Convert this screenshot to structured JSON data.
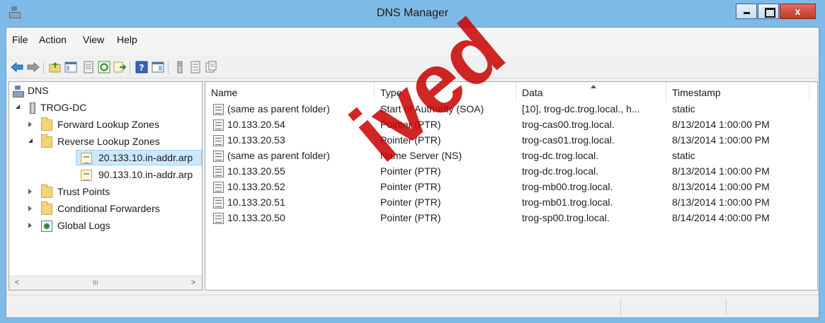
{
  "window": {
    "title": "DNS Manager",
    "close_glyph": "x"
  },
  "menu": [
    "File",
    "Action",
    "View",
    "Help"
  ],
  "toolbar": {
    "icons": [
      "back-icon",
      "forward-icon",
      "up-folder-icon",
      "show-tree-icon",
      "properties-icon",
      "refresh-icon",
      "export-icon",
      "help-icon",
      "console-tree-icon",
      "server-icon",
      "zone-icon",
      "record-icon"
    ]
  },
  "tree": {
    "root": "DNS",
    "server": "TROG-DC",
    "items": [
      {
        "label": "Forward Lookup Zones"
      },
      {
        "label": "Reverse Lookup Zones"
      },
      {
        "label": "20.133.10.in-addr.arp",
        "selected": true
      },
      {
        "label": "90.133.10.in-addr.arp"
      },
      {
        "label": "Trust Points"
      },
      {
        "label": "Conditional Forwarders"
      },
      {
        "label": "Global Logs"
      }
    ],
    "scroll_left": "<",
    "scroll_thumb": "III",
    "scroll_right": ">"
  },
  "list": {
    "columns": [
      "Name",
      "Type",
      "Data",
      "Timestamp"
    ],
    "rows": [
      {
        "name": "(same as parent folder)",
        "type": "Start of Authority (SOA)",
        "data": "[10], trog-dc.trog.local., h...",
        "timestamp": "static"
      },
      {
        "name": "10.133.20.54",
        "type": "Pointer (PTR)",
        "data": "trog-cas00.trog.local.",
        "timestamp": "8/13/2014 1:00:00 PM"
      },
      {
        "name": "10.133.20.53",
        "type": "Pointer (PTR)",
        "data": "trog-cas01.trog.local.",
        "timestamp": "8/13/2014 1:00:00 PM"
      },
      {
        "name": "(same as parent folder)",
        "type": "Name Server (NS)",
        "data": "trog-dc.trog.local.",
        "timestamp": "static"
      },
      {
        "name": "10.133.20.55",
        "type": "Pointer (PTR)",
        "data": "trog-dc.trog.local.",
        "timestamp": "8/13/2014 1:00:00 PM"
      },
      {
        "name": "10.133.20.52",
        "type": "Pointer (PTR)",
        "data": "trog-mb00.trog.local.",
        "timestamp": "8/13/2014 1:00:00 PM"
      },
      {
        "name": "10.133.20.51",
        "type": "Pointer (PTR)",
        "data": "trog-mb01.trog.local.",
        "timestamp": "8/13/2014 1:00:00 PM"
      },
      {
        "name": "10.133.20.50",
        "type": "Pointer (PTR)",
        "data": "trog-sp00.trog.local.",
        "timestamp": "8/14/2014 4:00:00 PM"
      }
    ]
  },
  "watermark": "ived",
  "colors": {
    "titlebar": "#7dbbe6",
    "selection": "#cce8ff",
    "watermark": "#c80000"
  }
}
